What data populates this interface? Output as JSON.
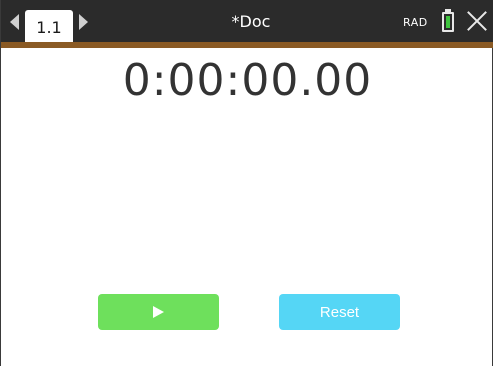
{
  "header": {
    "tab_label": "1.1",
    "doc_title": "*Doc",
    "angle_mode": "RAD",
    "battery_color": "#3ec43e",
    "accent_color": "#8a5a24"
  },
  "timer": {
    "display": "0:00:00.00"
  },
  "controls": {
    "play_icon": "play-icon",
    "play_color": "#6ee05c",
    "reset_label": "Reset",
    "reset_color": "#55d6f5"
  }
}
